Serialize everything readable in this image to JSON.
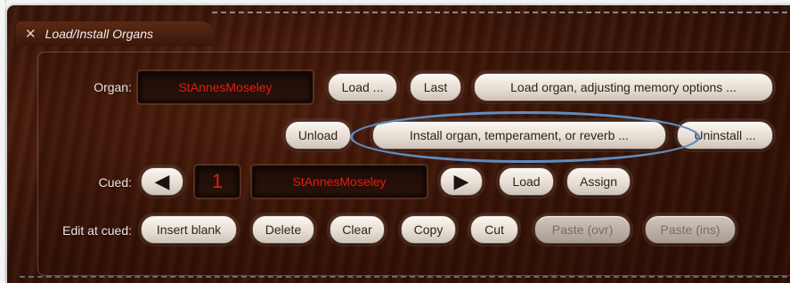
{
  "window": {
    "title": "Load/Install Organs",
    "close_glyph": "✕"
  },
  "organ_row": {
    "label": "Organ:",
    "display_value": "StAnnesMoseley",
    "load_button": "Load ...",
    "last_button": "Last",
    "load_adjust_button": "Load organ, adjusting memory options ..."
  },
  "install_row": {
    "unload_button": "Unload",
    "install_button": "Install organ, temperament, or reverb ...",
    "uninstall_button": "Uninstall ..."
  },
  "cued_row": {
    "label": "Cued:",
    "prev_glyph": "◀",
    "index_value": "1",
    "display_value": "StAnnesMoseley",
    "next_glyph": "▶",
    "load_button": "Load",
    "assign_button": "Assign"
  },
  "edit_row": {
    "label": "Edit at cued:",
    "insert_blank_button": "Insert blank",
    "delete_button": "Delete",
    "clear_button": "Clear",
    "copy_button": "Copy",
    "cut_button": "Cut",
    "paste_ovr_button": "Paste (ovr)",
    "paste_ins_button": "Paste (ins)"
  },
  "colors": {
    "display_text": "#e11d12",
    "highlight_ellipse": "#5f8cc0",
    "wood_dark": "#2a0d04",
    "button_face": "#efe7df"
  }
}
